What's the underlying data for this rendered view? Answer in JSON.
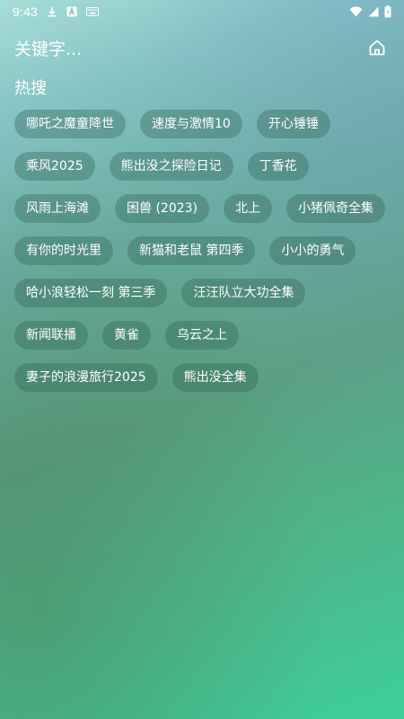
{
  "status_bar": {
    "time": "9:43",
    "left_icons": [
      "download-icon",
      "a-letter-icon",
      "keyboard-icon"
    ],
    "right_icons": [
      "wifi-icon",
      "signal-icon",
      "battery-icon"
    ]
  },
  "header": {
    "placeholder": "关键字...",
    "home_icon": "home-icon"
  },
  "hot_search": {
    "title": "热搜",
    "tags": [
      "哪吒之魔童降世",
      "速度与激情10",
      "开心锤锤",
      "乘风2025",
      "熊出没之探险日记",
      "丁香花",
      "风雨上海滩",
      "困兽 (2023)",
      "北上",
      "小猪佩奇全集",
      "有你的时光里",
      "新猫和老鼠 第四季",
      "小小的勇气",
      "哈小浪轻松一刻 第三季",
      "汪汪队立大功全集",
      "新闻联播",
      "黄雀",
      "乌云之上",
      "妻子的浪漫旅行2025",
      "熊出没全集"
    ]
  },
  "colors": {
    "gradient_top": "#a7ddd8",
    "gradient_bottom": "#3dcf9b",
    "tag_background": "rgba(45,95,80,0.35)",
    "text": "#ffffff"
  }
}
